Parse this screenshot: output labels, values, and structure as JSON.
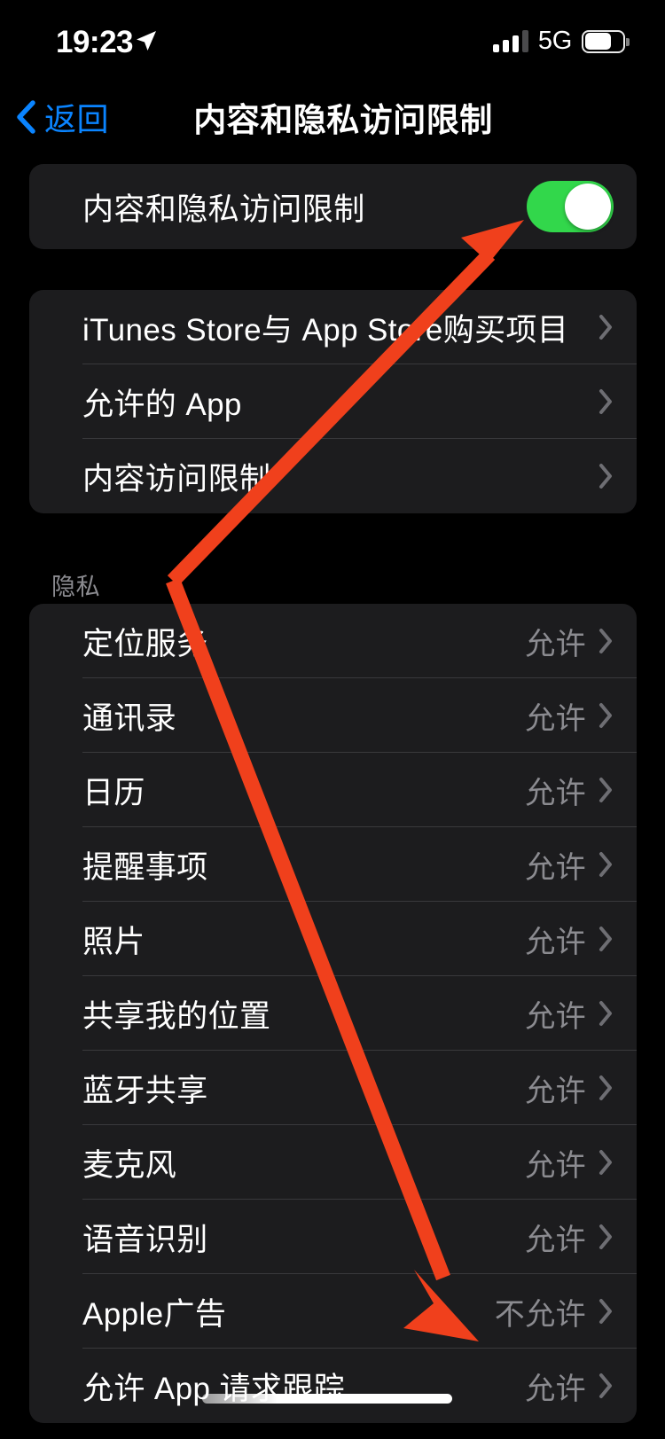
{
  "status_bar": {
    "time": "19:23",
    "location_icon": "location-arrow-icon",
    "signal_icon": "cellular-signal-icon",
    "network_type": "5G",
    "battery_icon": "battery-icon",
    "battery_level_percent": 68
  },
  "nav_bar": {
    "back_label": "返回",
    "back_icon": "chevron-left-icon",
    "title": "内容和隐私访问限制",
    "back_color": "#0A84FF"
  },
  "main_toggle": {
    "label": "内容和隐私访问限制",
    "state": "on",
    "on_color": "#32D74B"
  },
  "restrictions_group": {
    "items": [
      {
        "label": "iTunes Store与 App Store购买项目",
        "value": "",
        "accessory": "chevron-right-icon"
      },
      {
        "label": "允许的 App",
        "value": "",
        "accessory": "chevron-right-icon"
      },
      {
        "label": "内容访问限制",
        "value": "",
        "accessory": "chevron-right-icon"
      }
    ]
  },
  "privacy_section": {
    "header": "隐私",
    "items": [
      {
        "label": "定位服务",
        "value": "允许",
        "accessory": "chevron-right-icon"
      },
      {
        "label": "通讯录",
        "value": "允许",
        "accessory": "chevron-right-icon"
      },
      {
        "label": "日历",
        "value": "允许",
        "accessory": "chevron-right-icon"
      },
      {
        "label": "提醒事项",
        "value": "允许",
        "accessory": "chevron-right-icon"
      },
      {
        "label": "照片",
        "value": "允许",
        "accessory": "chevron-right-icon"
      },
      {
        "label": "共享我的位置",
        "value": "允许",
        "accessory": "chevron-right-icon"
      },
      {
        "label": "蓝牙共享",
        "value": "允许",
        "accessory": "chevron-right-icon"
      },
      {
        "label": "麦克风",
        "value": "允许",
        "accessory": "chevron-right-icon"
      },
      {
        "label": "语音识别",
        "value": "允许",
        "accessory": "chevron-right-icon"
      },
      {
        "label": "Apple广告",
        "value": "不允许",
        "accessory": "chevron-right-icon"
      },
      {
        "label": "允许 App 请求跟踪",
        "value": "允许",
        "accessory": "chevron-right-icon"
      }
    ]
  },
  "annotation": {
    "type": "double-headed-arrow",
    "color": "#F0401C",
    "points_to": [
      "内容和隐私访问限制 toggle",
      "Apple广告 不允许"
    ]
  },
  "home_indicator": {
    "name": "home-indicator"
  }
}
